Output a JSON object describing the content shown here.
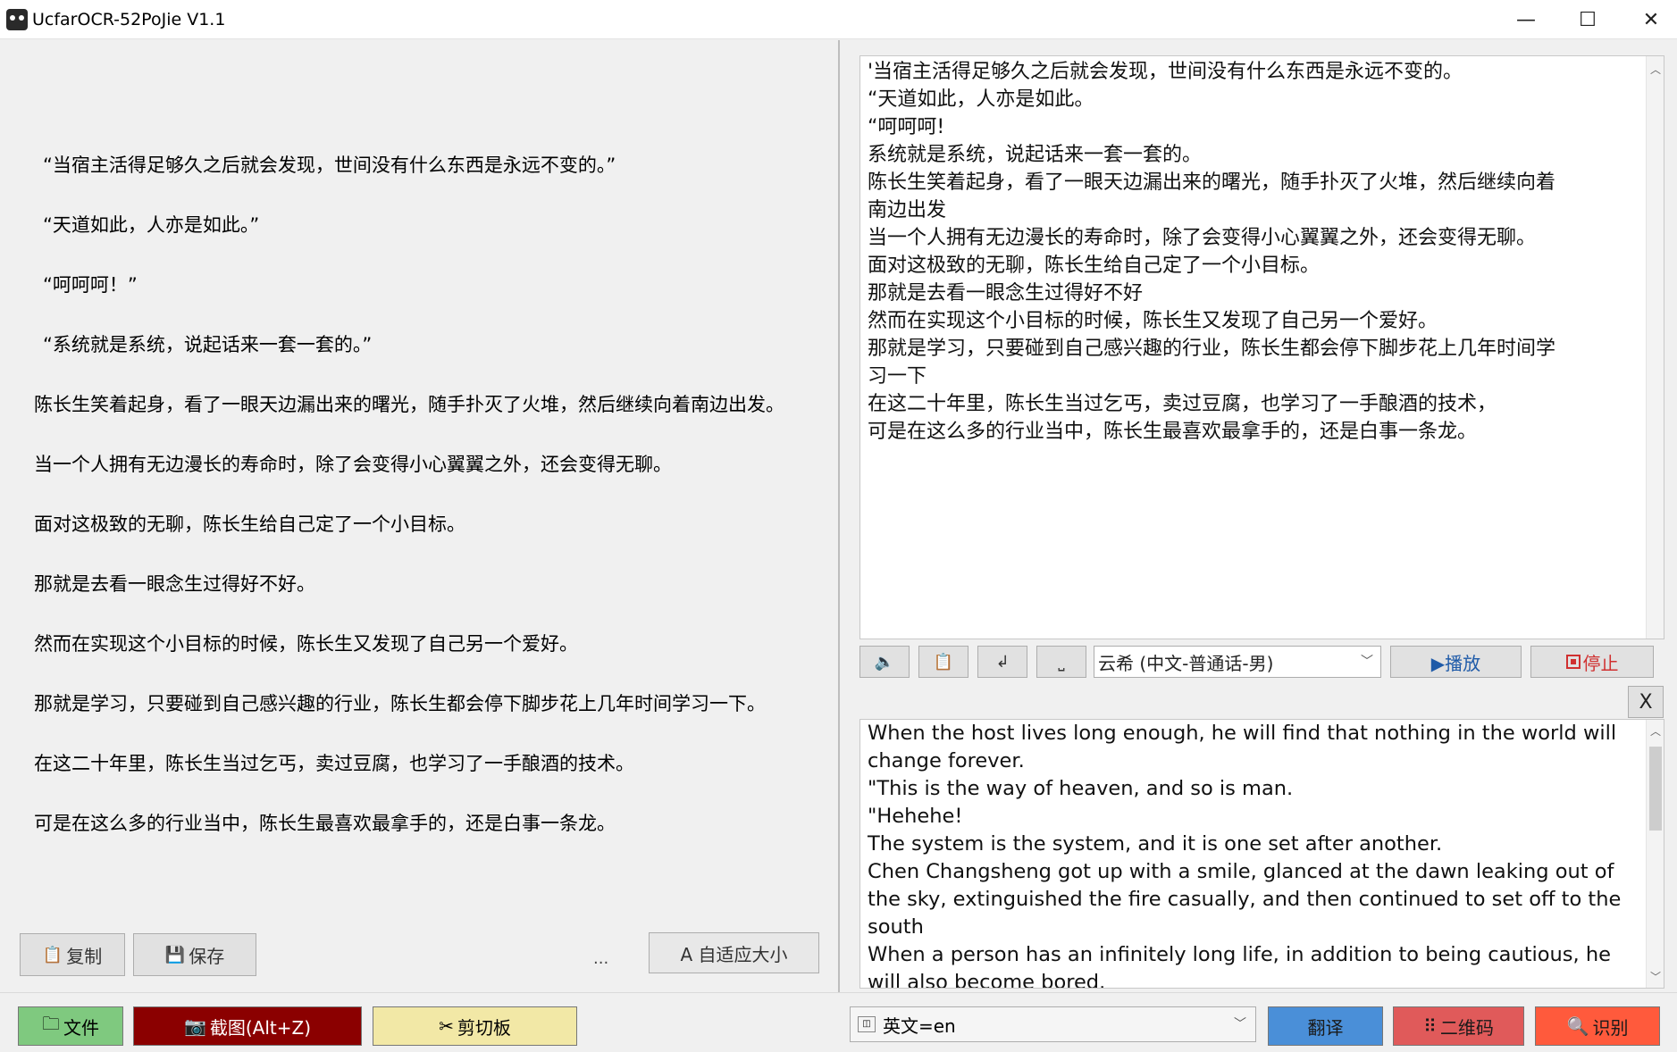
{
  "window": {
    "title": "UcfarOCR-52PoJie V1.1",
    "minimize": "—",
    "maximize": "☐",
    "close": "✕"
  },
  "left": {
    "paragraphs": [
      "“当宿主活得足够久之后就会发现，世间没有什么东西是永远不变的。”",
      "“天道如此，人亦是如此。”",
      "“呵呵呵！”",
      "“系统就是系统，说起话来一套一套的。”",
      "陈长生笑着起身，看了一眼天边漏出来的曙光，随手扑灭了火堆，然后继续向着南边出发。",
      "当一个人拥有无边漫长的寿命时，除了会变得小心翼翼之外，还会变得无聊。",
      "面对这极致的无聊，陈长生给自己定了一个小目标。",
      "那就是去看一眼念生过得好不好。",
      "然而在实现这个小目标的时候，陈长生又发现了自己另一个爱好。",
      "那就是学习，只要碰到自己感兴趣的行业，陈长生都会停下脚步花上几年时间学习一下。",
      "在这二十年里，陈长生当过乞丐，卖过豆腐，也学习了一手酿酒的技术。",
      "可是在这么多的行业当中，陈长生最喜欢最拿手的，还是白事一条龙。"
    ],
    "copy_label": "复制",
    "save_label": "保存",
    "ellipsis": "...",
    "autofit_label": "A 自适应大小"
  },
  "ocr": {
    "lines": [
      "'当宿主活得足够久之后就会发现，世间没有什么东西是永远不变的。",
      "“天道如此，人亦是如此。",
      "“呵呵呵!",
      "系统就是系统，说起话来一套一套的。",
      "陈长生笑着起身，看了一眼天边漏出来的曙光，随手扑灭了火堆，然后继续向着",
      "南边出发",
      "当一个人拥有无边漫长的寿命时，除了会变得小心翼翼之外，还会变得无聊。",
      "面对这极致的无聊，陈长生给自己定了一个小目标。",
      "那就是去看一眼念生过得好不好",
      "然而在实现这个小目标的时候，陈长生又发现了自己另一个爱好。",
      "那就是学习，只要碰到自己感兴趣的行业，陈长生都会停下脚步花上几年时间学",
      "习一下",
      "在这二十年里，陈长生当过乞丐，卖过豆腐，也学习了一手酿酒的技术，",
      "可是在这么多的行业当中，陈长生最喜欢最拿手的，还是白事一条龙。"
    ]
  },
  "tts": {
    "voice": "云希 (中文-普通话-男)",
    "play_label": "▶播放",
    "stop_label": "停止",
    "enter_glyph": "↲",
    "space_glyph": "⎵"
  },
  "translation": {
    "close_label": "X",
    "lines": [
      "When the host lives long enough, he will find that nothing in the world will",
      "change forever.",
      "\"This is the way of heaven, and so is man.",
      "\"Hehehe!",
      "The system is the system, and it is one set after another.",
      "Chen Changsheng got up with a smile, glanced at the dawn leaking out of",
      "the sky, extinguished the fire casually, and then continued to set off to the",
      "south",
      "When a person has an infinitely long life, in addition to being cautious, he",
      "will also become bored."
    ]
  },
  "bottom": {
    "file_label": "文件",
    "screenshot_label": "截图(Alt+Z)",
    "clipboard_label": "剪切板",
    "language": "英文=en",
    "translate_label": "翻译",
    "qrcode_label": "二维码",
    "recognize_label": "识别"
  },
  "colors": {
    "file_bg": "#7fc97f",
    "screenshot_bg": "#8b0000",
    "clipboard_bg": "#f2e8a6",
    "translate_bg": "#4a8fd8",
    "qrcode_bg": "#e05a5a",
    "recognize_bg": "#ff5a3c"
  }
}
